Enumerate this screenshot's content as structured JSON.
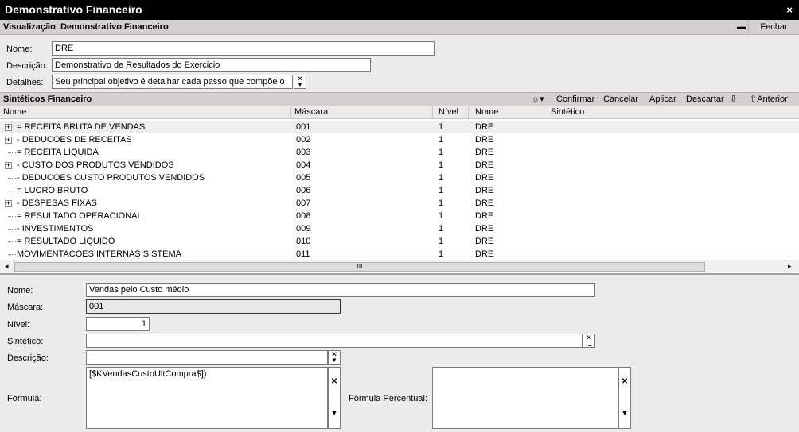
{
  "window": {
    "title": "Demonstrativo Financeiro",
    "close": "×"
  },
  "subbar": {
    "mode": "Visualização",
    "title": "Demonstrativo Financeiro",
    "minimize": "▬",
    "close_label": "Fechar"
  },
  "header_form": {
    "nome_label": "Nome:",
    "nome_value": "DRE",
    "descricao_label": "Descrição:",
    "descricao_value": "Demonstrativo de Resultados do Exercicio",
    "detalhes_label": "Detalhes:",
    "detalhes_value": "Seu principal objetivo é detalhar cada passo que compõe o"
  },
  "section": {
    "title": "Sintéticos Financeiro",
    "toolbar": {
      "filter_icon": "☼▾",
      "confirmar": "Confirmar",
      "cancelar": "Cancelar",
      "aplicar": "Aplicar",
      "descartar": "Descartar",
      "down_icon": "⇩",
      "anterior": "⇧Anterior"
    }
  },
  "grid": {
    "columns": [
      "Nome",
      "Máscara",
      "Nível",
      "Nome",
      "Sintético"
    ],
    "rows": [
      {
        "name": "= RECEITA BRUTA DE VENDAS",
        "mask": "001",
        "level": "1",
        "nome2": "DRE",
        "expandable": true
      },
      {
        "name": "- DEDUCOES DE RECEITAS",
        "mask": "002",
        "level": "1",
        "nome2": "DRE",
        "expandable": true
      },
      {
        "name": "= RECEITA LIQUIDA",
        "mask": "003",
        "level": "1",
        "nome2": "DRE",
        "expandable": false
      },
      {
        "name": "- CUSTO DOS PRODUTOS VENDIDOS",
        "mask": "004",
        "level": "1",
        "nome2": "DRE",
        "expandable": true
      },
      {
        "name": "- DEDUCOES CUSTO PRODUTOS VENDIDOS",
        "mask": "005",
        "level": "1",
        "nome2": "DRE",
        "expandable": false
      },
      {
        "name": "= LUCRO BRUTO",
        "mask": "006",
        "level": "1",
        "nome2": "DRE",
        "expandable": false
      },
      {
        "name": "- DESPESAS FIXAS",
        "mask": "007",
        "level": "1",
        "nome2": "DRE",
        "expandable": true
      },
      {
        "name": "= RESULTADO OPERACIONAL",
        "mask": "008",
        "level": "1",
        "nome2": "DRE",
        "expandable": false
      },
      {
        "name": "- INVESTIMENTOS",
        "mask": "009",
        "level": "1",
        "nome2": "DRE",
        "expandable": false
      },
      {
        "name": "= RESULTADO LIQUIDO",
        "mask": "010",
        "level": "1",
        "nome2": "DRE",
        "expandable": false
      },
      {
        "name": "MOVIMENTACOES INTERNAS SISTEMA",
        "mask": "011",
        "level": "1",
        "nome2": "DRE",
        "expandable": false
      }
    ],
    "scroll_left": "◂",
    "scroll_right": "▸",
    "scroll_grip": "III"
  },
  "detail_form": {
    "nome_label": "Nome:",
    "nome_value": "Vendas pelo Custo médio",
    "mascara_label": "Máscara:",
    "mascara_value": "001",
    "nivel_label": "Nível:",
    "nivel_value": "1",
    "sintetico_label": "Sintético:",
    "sintetico_value": "",
    "descricao_label": "Descrição:",
    "descricao_value": "",
    "formula_label": "Fórmula:",
    "formula_value": "[$KVendasCustoUltCompra$])",
    "formula_percentual_label": "Fórmula Percentual:",
    "formula_percentual_value": ""
  },
  "icons": {
    "clear": "✕",
    "dropdown": "▼",
    "ellipsis": "..."
  }
}
